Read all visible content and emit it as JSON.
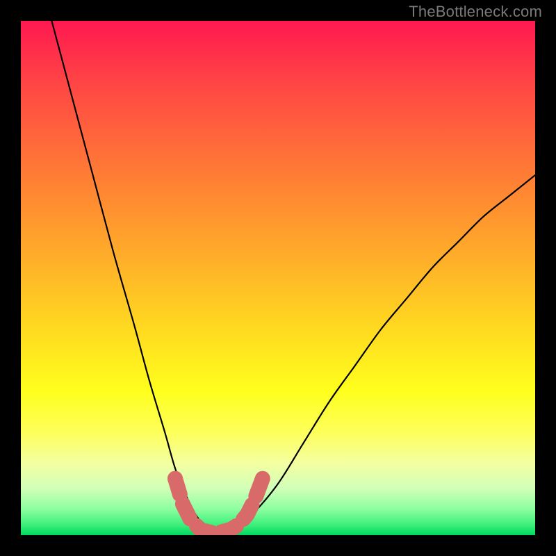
{
  "watermark": "TheBottleneck.com",
  "chart_data": {
    "type": "line",
    "title": "",
    "xlabel": "",
    "ylabel": "",
    "xlim": [
      0,
      100
    ],
    "ylim": [
      0,
      100
    ],
    "series": [
      {
        "name": "curve",
        "x": [
          6,
          10,
          14,
          18,
          22,
          25,
          28,
          30,
          32,
          34,
          36,
          38,
          40,
          42,
          45,
          50,
          55,
          60,
          65,
          70,
          75,
          80,
          85,
          90,
          95,
          100
        ],
        "values": [
          100,
          85,
          70,
          55,
          41,
          30,
          20,
          13,
          8,
          4,
          1.5,
          0.5,
          0.5,
          1.5,
          4,
          10,
          18,
          26,
          33,
          40,
          46,
          52,
          57,
          62,
          66,
          70
        ]
      }
    ],
    "markers": {
      "name": "highlight",
      "color": "#d86a6a",
      "points": [
        {
          "x": 30,
          "y": 11
        },
        {
          "x": 31.5,
          "y": 6
        },
        {
          "x": 33,
          "y": 3
        },
        {
          "x": 35,
          "y": 1
        },
        {
          "x": 37,
          "y": 0.5
        },
        {
          "x": 39,
          "y": 0.6
        },
        {
          "x": 41,
          "y": 1.2
        },
        {
          "x": 42.5,
          "y": 2.2
        },
        {
          "x": 44,
          "y": 4
        },
        {
          "x": 45.5,
          "y": 7
        },
        {
          "x": 47,
          "y": 11
        }
      ]
    },
    "background_gradient": {
      "top": "#ff1850",
      "mid": "#ffff1d",
      "bottom": "#00d860"
    }
  }
}
